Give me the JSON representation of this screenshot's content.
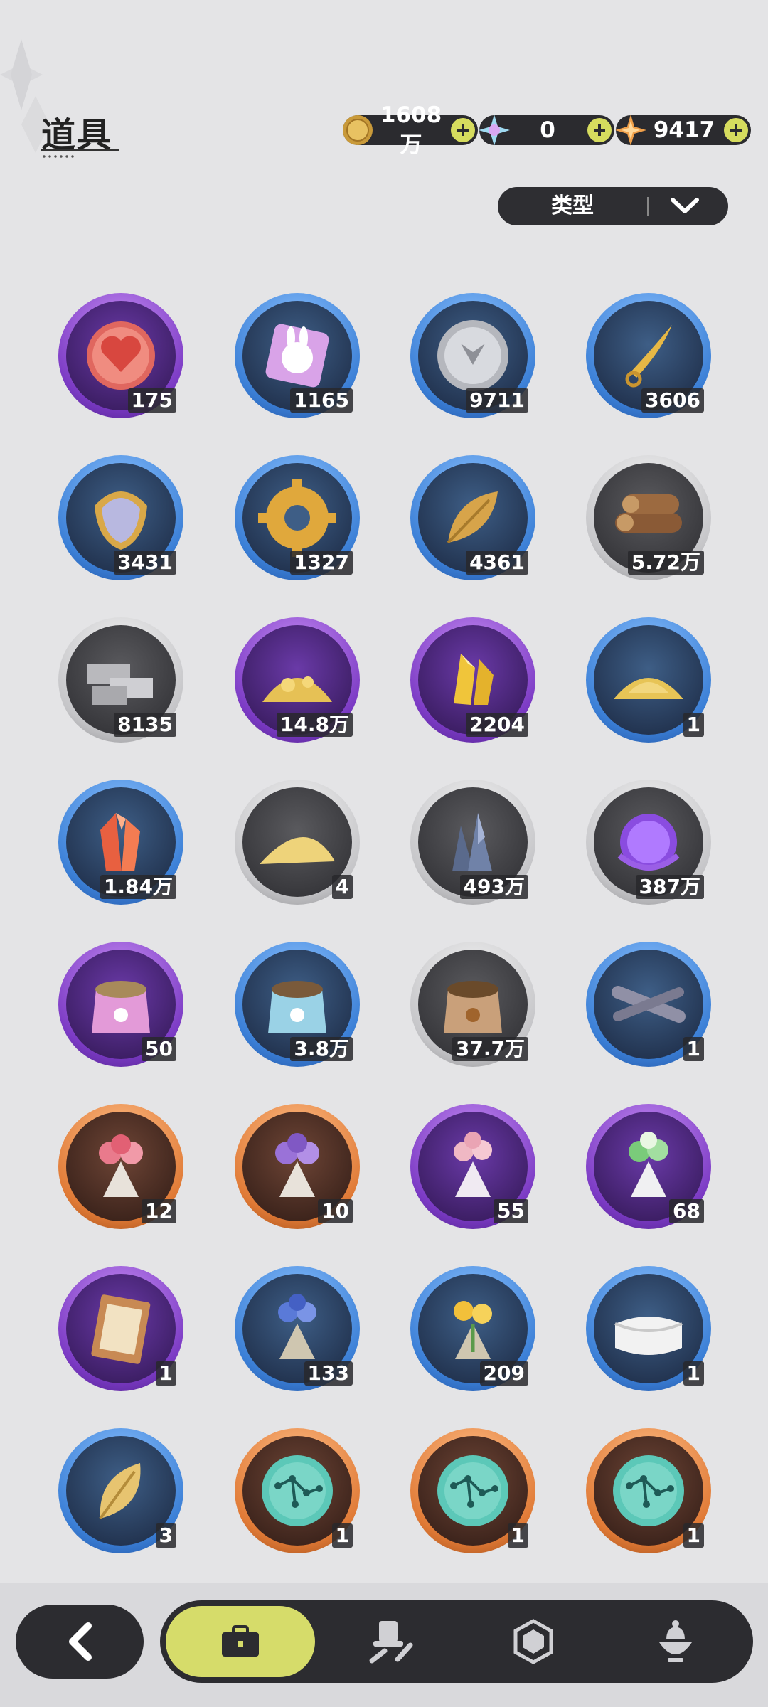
{
  "header": {
    "title": "道具",
    "currencies": [
      {
        "icon": "gold-coin-icon",
        "value": "1608万"
      },
      {
        "icon": "crystal-star-icon",
        "value": "0"
      },
      {
        "icon": "orange-star-icon",
        "value": "9417"
      }
    ]
  },
  "filter": {
    "label": "类型"
  },
  "items": [
    {
      "icon": "heart-coin-icon",
      "rarity": "purple",
      "count": "175"
    },
    {
      "icon": "rabbit-badge-icon",
      "rarity": "blue",
      "count": "1165"
    },
    {
      "icon": "silver-coin-icon",
      "rarity": "blue",
      "count": "9711"
    },
    {
      "icon": "golden-blade-icon",
      "rarity": "blue",
      "count": "3606"
    },
    {
      "icon": "scale-shield-icon",
      "rarity": "blue",
      "count": "3431"
    },
    {
      "icon": "gear-icon",
      "rarity": "blue",
      "count": "1327"
    },
    {
      "icon": "golden-leaf-icon",
      "rarity": "blue",
      "count": "4361"
    },
    {
      "icon": "wood-logs-icon",
      "rarity": "gray",
      "count": "5.72万"
    },
    {
      "icon": "stone-bricks-icon",
      "rarity": "gray",
      "count": "8135"
    },
    {
      "icon": "gold-ore-icon",
      "rarity": "purple",
      "count": "14.8万"
    },
    {
      "icon": "gold-crystal-icon",
      "rarity": "purple",
      "count": "2204"
    },
    {
      "icon": "gold-sand-icon",
      "rarity": "blue",
      "count": "1"
    },
    {
      "icon": "red-crystal-icon",
      "rarity": "blue",
      "count": "1.84万"
    },
    {
      "icon": "sand-pile-icon",
      "rarity": "gray",
      "count": "4"
    },
    {
      "icon": "dark-crystal-icon",
      "rarity": "gray",
      "count": "493万"
    },
    {
      "icon": "purple-orb-icon",
      "rarity": "gray",
      "count": "387万"
    },
    {
      "icon": "pink-food-bag-icon",
      "rarity": "purple",
      "count": "50"
    },
    {
      "icon": "blue-food-bag-icon",
      "rarity": "blue",
      "count": "3.8万"
    },
    {
      "icon": "brown-food-bag-icon",
      "rarity": "gray",
      "count": "37.7万"
    },
    {
      "icon": "lavender-bundle-icon",
      "rarity": "blue",
      "count": "1"
    },
    {
      "icon": "pink-bouquet-icon",
      "rarity": "orange",
      "count": "12"
    },
    {
      "icon": "violet-bouquet-icon",
      "rarity": "orange",
      "count": "10"
    },
    {
      "icon": "blossom-bouquet-icon",
      "rarity": "purple",
      "count": "55"
    },
    {
      "icon": "green-bouquet-icon",
      "rarity": "purple",
      "count": "68"
    },
    {
      "icon": "book-icon",
      "rarity": "purple",
      "count": "1"
    },
    {
      "icon": "blue-bouquet-icon",
      "rarity": "blue",
      "count": "133"
    },
    {
      "icon": "yellow-bouquet-icon",
      "rarity": "blue",
      "count": "209"
    },
    {
      "icon": "white-cloth-icon",
      "rarity": "blue",
      "count": "1"
    },
    {
      "icon": "pale-leaf-icon",
      "rarity": "blue",
      "count": "3"
    },
    {
      "icon": "constellation-orb-icon",
      "rarity": "orange",
      "count": "1"
    },
    {
      "icon": "constellation-orb-icon",
      "rarity": "orange",
      "count": "1"
    },
    {
      "icon": "constellation-orb-icon",
      "rarity": "orange",
      "count": "1"
    }
  ],
  "bottom_nav": {
    "back": "back-arrow-icon",
    "tabs": [
      {
        "icon": "briefcase-icon",
        "active": true
      },
      {
        "icon": "hat-and-tools-icon",
        "active": false
      },
      {
        "icon": "hexagon-gem-icon",
        "active": false
      },
      {
        "icon": "dessert-bowl-icon",
        "active": false
      }
    ]
  }
}
